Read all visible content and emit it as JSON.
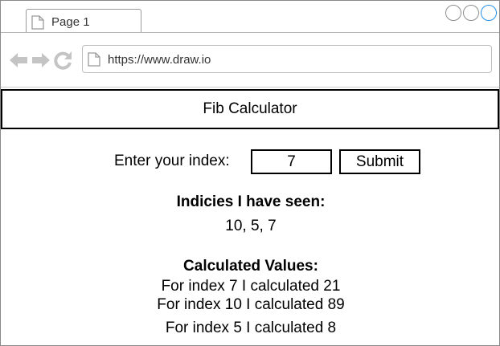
{
  "browser": {
    "tab_label": "Page 1",
    "url": "https://www.draw.io"
  },
  "app": {
    "title": "Fib Calculator"
  },
  "form": {
    "label": "Enter your index:",
    "input_value": "7",
    "submit_label": "Submit"
  },
  "seen": {
    "heading": "Indicies I have seen:",
    "values": "10, 5, 7"
  },
  "calculated": {
    "heading": "Calculated Values:",
    "rows": [
      "For index 7 I calculated 21",
      "For index 10 I calculated 89",
      "For index 5 I calculated 8"
    ]
  },
  "icons": {
    "tab": "page-icon",
    "back": "back-arrow-icon",
    "forward": "forward-arrow-icon",
    "reload": "reload-icon",
    "address": "page-icon"
  }
}
